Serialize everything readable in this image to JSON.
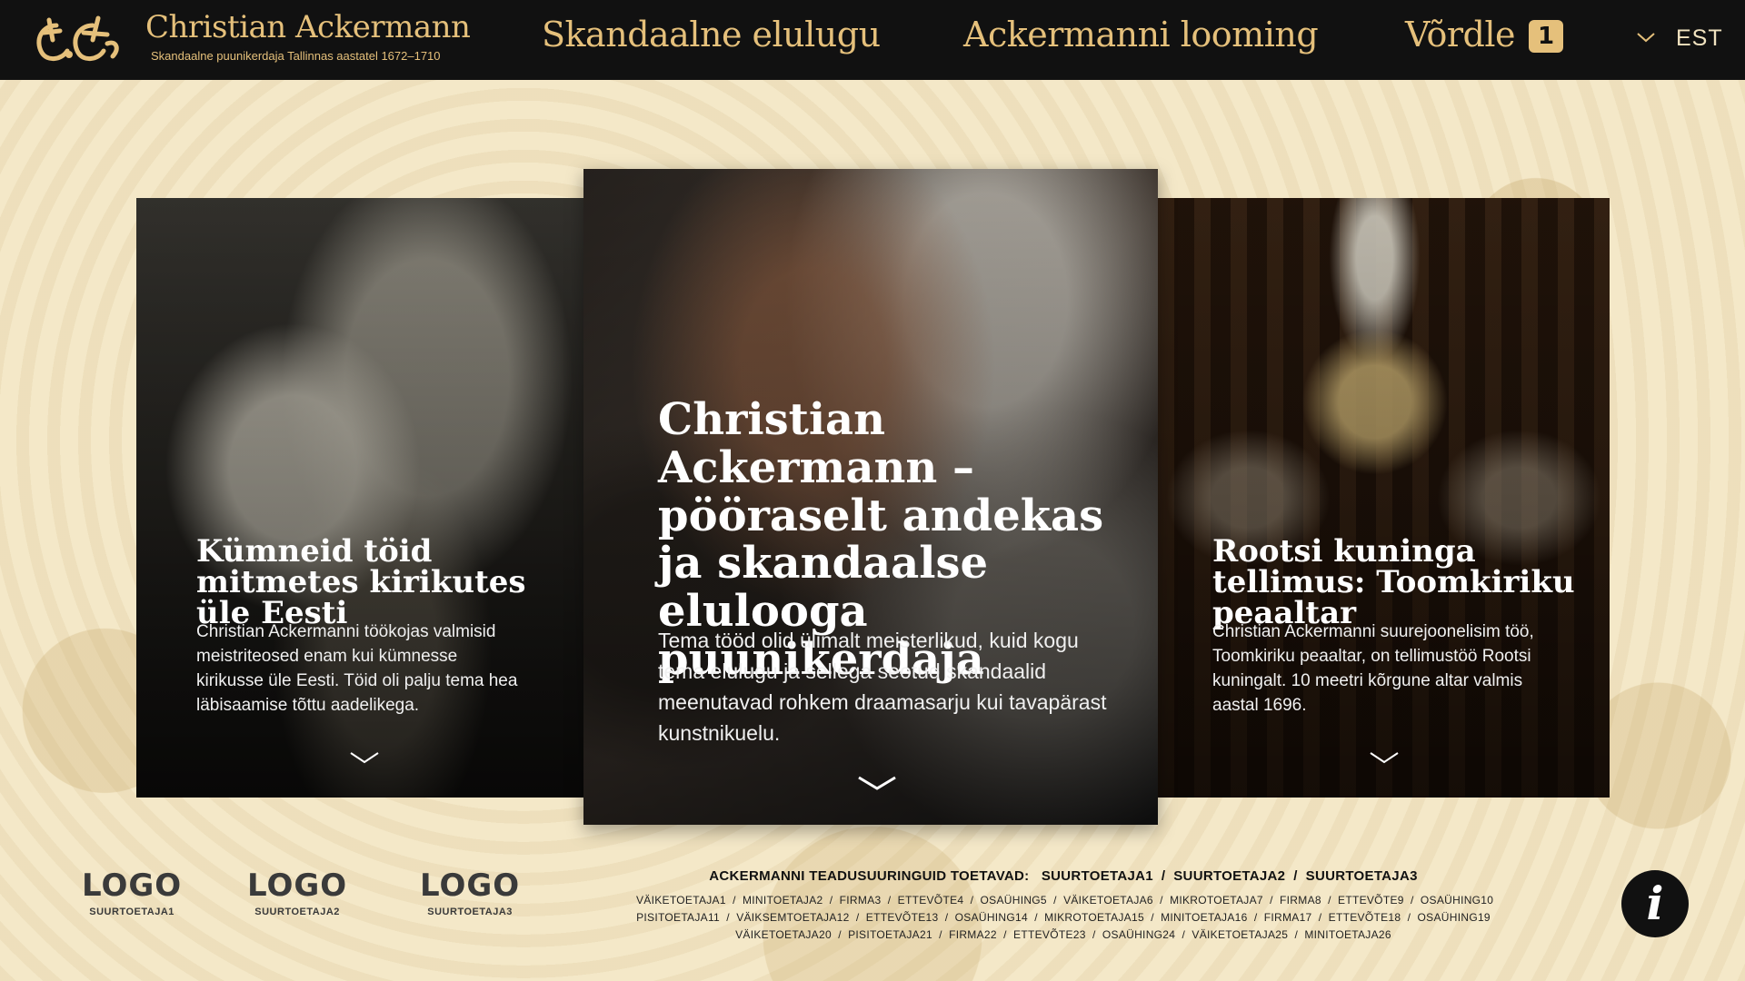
{
  "header": {
    "brand_title": "Christian Ackermann",
    "brand_subtitle": "Skandaalne puunikerdaja Tallinnas  aastatel 1672–1710",
    "nav": [
      {
        "label": "Skandaalne elulugu"
      },
      {
        "label": "Ackermanni looming"
      },
      {
        "label": "Võrdle"
      }
    ],
    "compare_count": "1",
    "language": "EST",
    "accent_color": "#e5c07b"
  },
  "cards": [
    {
      "title": "Kümneid töid mitmetes kirikutes üle Eesti",
      "text": "Christian Ackermanni töökojas valmisid meistriteosed enam kui kümnesse kirikusse üle Eesti. Töid oli palju tema hea läbisaamise tõttu aadelikega."
    },
    {
      "title": "Christian Ackermann – pööraselt andekas ja skandaalse elulooga puunikerdaja",
      "text": "Tema tööd olid ülimalt meisterlikud, kuid kogu tema elulugu ja sellega seotud skandaalid meenutavad rohkem draamasarju kui tavapärast kunstnikuelu."
    },
    {
      "title": "Rootsi kuninga tellimus: Toomkiriku peaaltar",
      "text": "Christian Ackermanni suurejoonelisim töö, Toomkiriku peaaltar, on tellimustöö Rootsi kuningalt. 10 meetri kõrgune altar valmis aastal 1696."
    }
  ],
  "footer": {
    "logos": [
      {
        "big": "LOGO",
        "small": "SUURTOETAJA1"
      },
      {
        "big": "LOGO",
        "small": "SUURTOETAJA2"
      },
      {
        "big": "LOGO",
        "small": "SUURTOETAJA3"
      }
    ],
    "supporters_heading": "ACKERMANNI TEADUSUURINGUID TOETAVAD:   SUURTOETAJA1  /  SUURTOETAJA2  /  SUURTOETAJA3",
    "supporters_line1": "VÄIKETOETAJA1  /  MINITOETAJA2  /  FIRMA3  /  ETTEVÕTE4  /  OSAÜHING5  /  VÄIKETOETAJA6  /  MIKROTOETAJA7  /  FIRMA8  /  ETTEVÕTE9  /  OSAÜHING10",
    "supporters_line2": "PISITOETAJA11  /  VÄIKSEMTOETAJA12  /  ETTEVÕTE13  /  OSAÜHING14  /  MIKROTOETAJA15  /  MINITOETAJA16  /  FIRMA17  /  ETTEVÕTE18  /  OSAÜHING19",
    "supporters_line3": "VÄIKETOETAJA20  /  PISITOETAJA21  /  FIRMA22  /  ETTEVÕTE23  /  OSAÜHING24  /  VÄIKETOETAJA25  /  MINITOETAJA26",
    "info_label": "i"
  }
}
